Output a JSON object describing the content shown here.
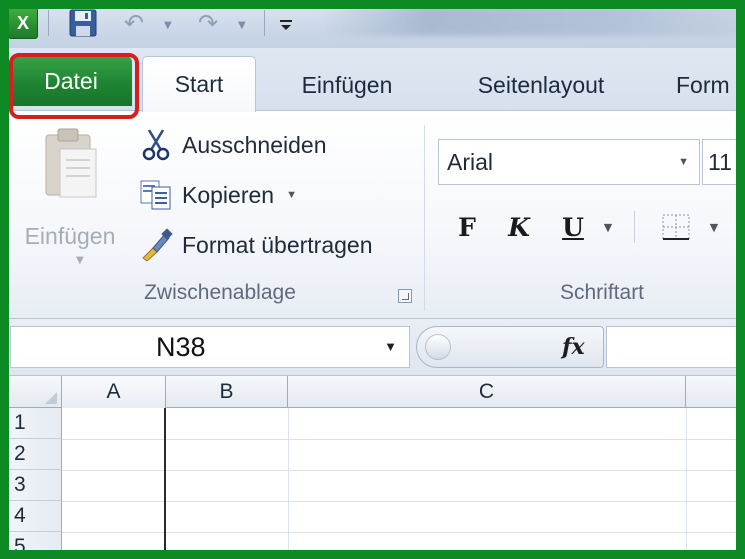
{
  "app": {
    "icon_letter": "X"
  },
  "quick_access": {
    "icons": [
      "excel-icon",
      "save-icon",
      "undo-icon",
      "redo-icon",
      "customize-toolbar-icon"
    ]
  },
  "tabs": [
    {
      "label": "Datei",
      "active": false,
      "highlighted": true
    },
    {
      "label": "Start",
      "active": true
    },
    {
      "label": "Einfügen",
      "active": false
    },
    {
      "label": "Seitenlayout",
      "active": false
    },
    {
      "label": "Form",
      "active": false
    }
  ],
  "clipboard_group": {
    "paste_label": "Einfügen",
    "cut_label": "Ausschneiden",
    "copy_label": "Kopieren",
    "format_painter_label": "Format übertragen",
    "group_label": "Zwischenablage"
  },
  "font_group": {
    "font_name": "Arial",
    "font_size": "11",
    "bold_label": "F",
    "italic_label": "K",
    "underline_label": "U",
    "group_label": "Schriftart"
  },
  "formula_bar": {
    "name_box": "N38",
    "fx_label": "fx"
  },
  "grid": {
    "columns": [
      "A",
      "B",
      "C",
      ""
    ],
    "rows": [
      "1",
      "2",
      "3",
      "4",
      "5"
    ]
  },
  "colors": {
    "frame_green": "#0e8a24",
    "file_tab_green": "#1f8432",
    "highlight_red": "#d42020"
  }
}
